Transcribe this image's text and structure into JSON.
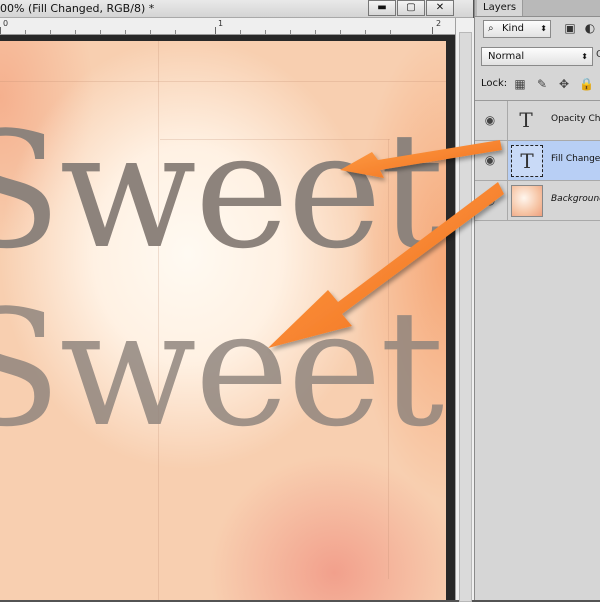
{
  "document": {
    "title": "00% (Fill Changed, RGB/8) *",
    "window_buttons": [
      {
        "name": "minimize",
        "glyph": "▬"
      },
      {
        "name": "maximize",
        "glyph": "▢"
      },
      {
        "name": "close",
        "glyph": "✕"
      }
    ],
    "ruler_numbers": [
      "0",
      "1",
      "2"
    ],
    "canvas_text": {
      "line1": "Sweet",
      "line2": "Sweet",
      "text_color": "#8d837c"
    },
    "annotation_color": "#f7852f"
  },
  "layers_panel": {
    "tab_label": "Layers",
    "filter": {
      "search_icon": "magnifier-icon",
      "kind_label": "Kind",
      "icons": [
        "image-filter-icon",
        "adjustment-filter-icon"
      ]
    },
    "blend_mode": "Normal",
    "blend_extra": "O",
    "lock_label": "Lock:",
    "lock_icons": [
      "lock-transparent-icon",
      "lock-paint-icon",
      "lock-position-icon",
      "lock-all-icon"
    ],
    "layers": [
      {
        "name": "Opacity Cha",
        "type": "text",
        "thumb_glyph": "T",
        "visible": true,
        "selected": false
      },
      {
        "name": "Fill Changed",
        "type": "text",
        "thumb_glyph": "T",
        "visible": true,
        "selected": true
      },
      {
        "name": "Background",
        "type": "image",
        "thumb_glyph": "",
        "visible": true,
        "selected": false
      }
    ],
    "selection_color": "#b8cff5"
  }
}
